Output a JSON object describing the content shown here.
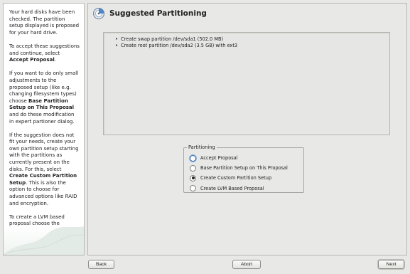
{
  "help": {
    "p1": "Your hard disks have been checked. The partition setup displayed is proposed for your hard drive.",
    "p2_pre": "To accept these suggestions and continue, select ",
    "p2_bold": "Accept Proposal",
    "p2_post": ".",
    "p3_pre": "If you want to do only small adjustments to the proposed setup (like e.g. changing filesystem types) choose ",
    "p3_bold": "Base Partition Setup on This Proposal",
    "p3_post": " and do these modification in expert partioner dialog.",
    "p4_pre": "If the suggestion does not fit your needs, create your own partition setup starting with the partitions as currently present on the disks. For this, select ",
    "p4_bold": "Create Custom Partition Setup",
    "p4_post": ". This is also the option to choose for advanced options like RAID and encryption.",
    "p5": "To create a LVM based proposal choose the corresponding button."
  },
  "title": "Suggested Partitioning",
  "proposal": [
    "Create swap partition /dev/sda1 (502.0 MB)",
    "Create root partition /dev/sda2 (3.5 GB) with ext3"
  ],
  "partitioning": {
    "legend": "Partitioning",
    "options": [
      {
        "label": "Accept Proposal",
        "checked": false,
        "focused": true
      },
      {
        "label": "Base Partition Setup on This Proposal",
        "checked": false,
        "focused": false
      },
      {
        "label": "Create Custom Partition Setup",
        "checked": true,
        "focused": false
      },
      {
        "label": "Create LVM Based Proposal",
        "checked": false,
        "focused": false
      }
    ]
  },
  "buttons": {
    "back": "Back",
    "abort": "Abort",
    "next": "Next"
  },
  "colors": {
    "background": "#e8e8e6",
    "help_bg": "#ffffff",
    "accent": "#3a6fb0"
  }
}
